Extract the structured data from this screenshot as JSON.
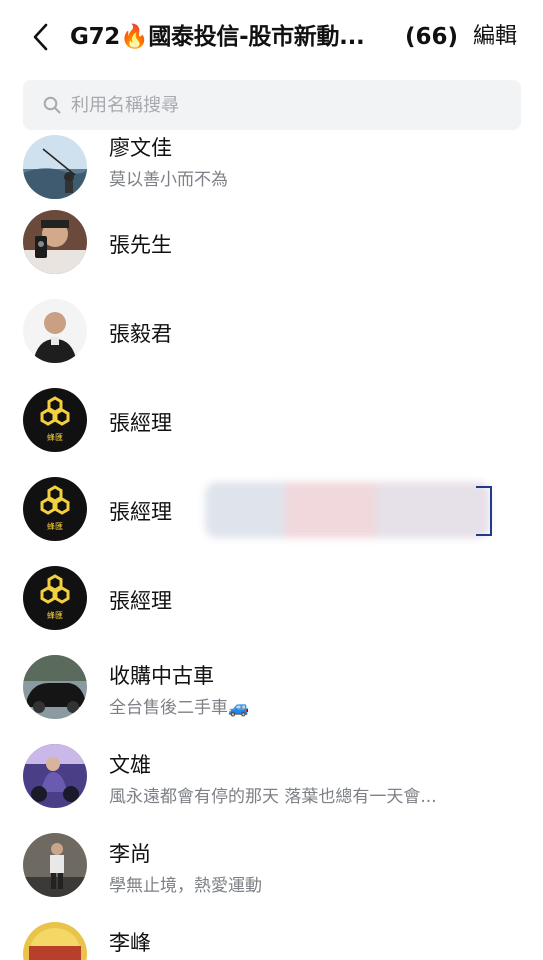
{
  "header": {
    "group_title": "G72🔥國泰投信-股市新動...",
    "member_count": "(66)",
    "edit_label": "編輯"
  },
  "search": {
    "placeholder": "利用名稱搜尋"
  },
  "members": [
    {
      "name": "廖文佳",
      "status": "莫以善小而不為",
      "avatar": "fishing-photo"
    },
    {
      "name": "張先生",
      "status": "",
      "avatar": "man-with-phone-photo"
    },
    {
      "name": "張毅君",
      "status": "",
      "avatar": "bald-man-photo"
    },
    {
      "name": "張經理",
      "status": "",
      "avatar": "honeycomb-logo",
      "logo_text": "蜂匯"
    },
    {
      "name": "張經理",
      "status": "",
      "avatar": "honeycomb-logo",
      "logo_text": "蜂匯"
    },
    {
      "name": "張經理",
      "status": "",
      "avatar": "honeycomb-logo",
      "logo_text": "蜂匯"
    },
    {
      "name": "收購中古車",
      "status": "全台售後二手車🚙",
      "avatar": "black-car-photo"
    },
    {
      "name": "文雄",
      "status": "風永遠都會有停的那天 落葉也總有一天會...",
      "avatar": "motorcycle-rider-photo"
    },
    {
      "name": "李尚",
      "status": "學無止境，熱愛運動",
      "avatar": "standing-man-photo"
    },
    {
      "name": "李峰",
      "status": "",
      "avatar": "gold-badge-logo"
    }
  ],
  "colors": {
    "logo_yellow": "#f4d03f",
    "logo_bg": "#111111",
    "status_gray": "#7d8086"
  }
}
